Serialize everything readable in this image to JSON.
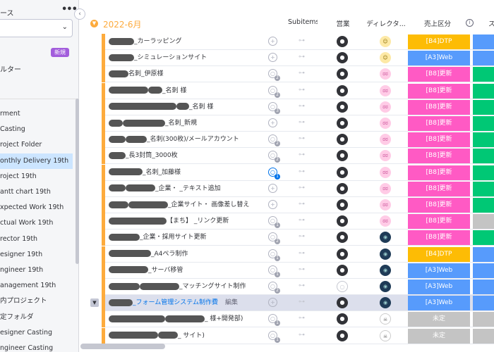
{
  "sidebar": {
    "title": "ース",
    "more": "•••",
    "select_chevron": "⌄",
    "badge": "新規",
    "filter_label": "ルター",
    "items": [
      {
        "label": "rment",
        "active": false
      },
      {
        "label": "Casting",
        "active": false
      },
      {
        "label": "roject Folder",
        "active": false
      },
      {
        "label": "onthly Delivery 19th",
        "active": true
      },
      {
        "label": "roject 19th",
        "active": false
      },
      {
        "label": "antt chart 19th",
        "active": false
      },
      {
        "label": "xpected Work 19th",
        "active": false
      },
      {
        "label": "ctual Work 19th",
        "active": false
      },
      {
        "label": "rector 19th",
        "active": false
      },
      {
        "label": "esigner 19th",
        "active": false
      },
      {
        "label": "ngineer 19th",
        "active": false
      },
      {
        "label": "anagement 19th",
        "active": false
      },
      {
        "label": "内プロジェクト",
        "active": false
      },
      {
        "label": "定フォルダ",
        "active": false
      },
      {
        "label": "esigner Casting",
        "active": false
      },
      {
        "label": "ngineer Casting",
        "active": false
      }
    ]
  },
  "board": {
    "group_title": "2022-6月",
    "columns": {
      "subitems": "Subitems",
      "sales": "営業",
      "director": "ディレクタ...",
      "category": "売上区分",
      "extra": "ス"
    },
    "colors": {
      "accent": "#fdab3d",
      "B4": "#fdbc05",
      "A3": "#579bfc",
      "B8": "#ff5ac4",
      "none": "#c4c4c4",
      "green": "#00c875"
    },
    "rows": [
      {
        "blur": [
          36
        ],
        "text": "_カーラッピング",
        "chat": "+",
        "count": "",
        "sales": "person",
        "director": "yel",
        "category": "[B4]DTP",
        "cat_color": "#fdbc05",
        "ext": "#579bfc"
      },
      {
        "blur": [
          36
        ],
        "text": "_シミュレーションサイト",
        "chat": "+",
        "count": "",
        "sales": "person",
        "director": "yel",
        "category": "[A3]Web",
        "cat_color": "#579bfc",
        "ext": "#579bfc"
      },
      {
        "blur": [
          28
        ],
        "text": "名刺_伊原様",
        "chat": "○",
        "count": "2",
        "sales": "person",
        "director": "pink",
        "category": "[B8]更新",
        "cat_color": "#ff5ac4",
        "ext": "#00c875"
      },
      {
        "blur": [
          56,
          20
        ],
        "text": "_名刺 様",
        "chat": "○",
        "count": "2",
        "sales": "person",
        "director": "pink",
        "category": "[B8]更新",
        "cat_color": "#ff5ac4",
        "ext": "#00c875"
      },
      {
        "blur": [
          96,
          18
        ],
        "text": "_名刺 様",
        "chat": "○",
        "count": "3",
        "sales": "person",
        "director": "pink",
        "category": "[B8]更新",
        "cat_color": "#ff5ac4",
        "ext": "#00c875"
      },
      {
        "blur": [
          20,
          60
        ],
        "text": "_名刺_新規",
        "chat": "+",
        "count": "",
        "sales": "person",
        "director": "pink",
        "category": "[B8]更新",
        "cat_color": "#ff5ac4",
        "ext": "#00c875"
      },
      {
        "blur": [
          24,
          30
        ],
        "text": "_名刺(300枚)/メールアカウント",
        "chat": "○",
        "count": "2",
        "sales": "person",
        "director": "pink",
        "category": "[B8]更新",
        "cat_color": "#ff5ac4",
        "ext": "#00c875"
      },
      {
        "blur": [
          24
        ],
        "text": "_長3封筒_3000枚",
        "chat": "○",
        "count": "2",
        "sales": "person",
        "director": "pink",
        "category": "[B8]更新",
        "cat_color": "#ff5ac4",
        "ext": "#00c875"
      },
      {
        "blur": [
          48
        ],
        "text": "_名刺_加藤様",
        "chat": "○",
        "count": "1",
        "active": true,
        "sales": "person",
        "director": "pink",
        "category": "[B8]更新",
        "cat_color": "#ff5ac4",
        "ext": "#00c875"
      },
      {
        "blur": [
          24,
          42
        ],
        "text": "_企業・ _テキスト追加",
        "chat": "+",
        "count": "",
        "sales": "person",
        "director": "pink",
        "category": "[B8]更新",
        "cat_color": "#ff5ac4",
        "ext": "#00c875"
      },
      {
        "blur": [
          28,
          56
        ],
        "text": "_企業サイト・ 画像差し替え",
        "chat": "+",
        "count": "",
        "sales": "person",
        "director": "pink",
        "category": "[B8]更新",
        "cat_color": "#ff5ac4",
        "ext": "#00c875"
      },
      {
        "blur": [
          82
        ],
        "text": "【まち】 _リンク更新",
        "chat": "○",
        "count": "1",
        "sales": "person",
        "director": "pink",
        "category": "[B8]更新",
        "cat_color": "#ff5ac4",
        "ext": "#c4c4c4"
      },
      {
        "blur": [
          44
        ],
        "text": "_企業・採用サイト更新",
        "chat": "○",
        "count": "2",
        "sales": "person",
        "director": "dark",
        "category": "[B8]更新",
        "cat_color": "#ff5ac4",
        "ext": "#00c875"
      },
      {
        "blur": [
          60
        ],
        "text": "_A4ペラ制作",
        "chat": "○",
        "count": "1",
        "sales": "person",
        "director": "dark",
        "category": "[B4]DTP",
        "cat_color": "#fdbc05",
        "ext": "#579bfc"
      },
      {
        "blur": [
          56
        ],
        "text": "_サーバ移管",
        "chat": "○",
        "count": "1",
        "sales": "person",
        "director": "dark",
        "category": "[A3]Web",
        "cat_color": "#579bfc",
        "ext": "#579bfc"
      },
      {
        "blur": [
          44,
          56
        ],
        "text": "_マッチングサイト制作",
        "chat": "○",
        "count": "2",
        "sales": "empty",
        "director": "dark",
        "category": "[A3]Web",
        "cat_color": "#579bfc",
        "ext": "#579bfc"
      },
      {
        "blur": [
          34
        ],
        "text": "_フォーム管理システム制作費",
        "edit": "編集",
        "sel": true,
        "chat": "+",
        "count": "",
        "sales": "person",
        "director": "dark",
        "category": "[A3]Web",
        "cat_color": "#579bfc",
        "ext": "#579bfc"
      },
      {
        "blur": [
          80,
          56
        ],
        "text": "_ 様+開発部)",
        "chat": "○",
        "count": "1",
        "sales": "person",
        "director": "sk",
        "category": "未定",
        "cat_color": "#c4c4c4",
        "ext": "#c4c4c4"
      },
      {
        "blur": [
          70,
          28
        ],
        "text": "_ サイト)",
        "chat": "○",
        "count": "1",
        "sales": "person",
        "director": "sk",
        "category": "未定",
        "cat_color": "#c4c4c4",
        "ext": "#c4c4c4"
      }
    ]
  }
}
